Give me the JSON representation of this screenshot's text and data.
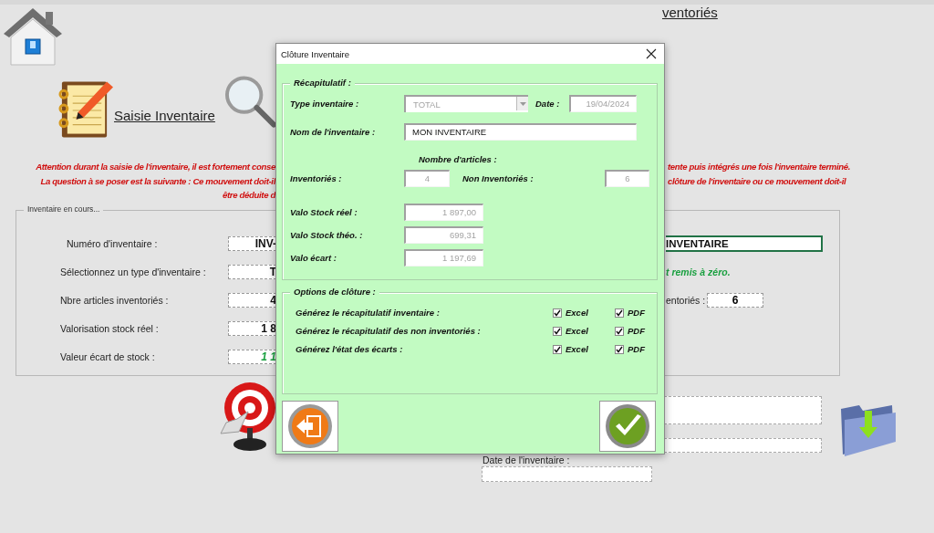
{
  "sheet": {
    "entry_link": "Saisie Inventaire",
    "inventoried_link": "ventoriés",
    "warning_lines": [
      {
        "left": "Attention durant la saisie de l'inventaire, il est fortement conse",
        "right": "tente puis intégrés une fois l'inventaire terminé."
      },
      {
        "left": "La question à se poser est la suivante : Ce mouvement doit-il",
        "right": "clôture de l'inventaire ou ce mouvement doit-il"
      },
      {
        "left": "être déduite d"
      }
    ],
    "current": {
      "legend": "Inventaire en cours...",
      "rows": [
        {
          "label": "Numéro d'inventaire :",
          "value": "INV-",
          "kind": "plain"
        },
        {
          "label": "Sélectionnez un type d'inventaire :",
          "value": "T",
          "kind": "plain"
        },
        {
          "label": "Nbre articles inventoriés :",
          "value": "4",
          "kind": "plain"
        },
        {
          "label": "Valorisation stock réel :",
          "value": "1 8",
          "kind": "plain"
        },
        {
          "label": "Valeur écart de stock :",
          "value": "1 1",
          "kind": "gain"
        }
      ],
      "name_value": "INVENTAIRE",
      "reset_notice": "t remis à zéro.",
      "not_inventoried_label": "entoriés :",
      "not_inventoried_value": "6"
    },
    "date_label": "Date de l'inventaire :"
  },
  "dialog": {
    "title": "Clôture Inventaire",
    "summary": {
      "legend": "Récapitulatif :",
      "type": {
        "label": "Type inventaire :",
        "value": "TOTAL",
        "disabled": true
      },
      "date": {
        "label": "Date :",
        "value": "19/04/2024",
        "disabled": true
      },
      "name": {
        "label": "Nom de l'inventaire :",
        "value": "MON INVENTAIRE",
        "disabled": false
      },
      "count_heading": "Nombre d'articles :",
      "inventoried": {
        "label": "Inventoriés :",
        "value": "4",
        "disabled": true
      },
      "not_inventoried": {
        "label": "Non Inventoriés :",
        "value": "6",
        "disabled": true
      },
      "valuations": [
        {
          "label": "Valo Stock réel :",
          "value": "1 897,00",
          "disabled": true
        },
        {
          "label": "Valo Stock théo. :",
          "value": "699,31",
          "disabled": true
        },
        {
          "label": "Valo écart :",
          "value": "1 197,69",
          "disabled": true
        }
      ]
    },
    "options": {
      "legend": "Options de clôture :",
      "rows": [
        {
          "label": "Générez le récapitulatif inventaire :",
          "formats": [
            {
              "label": "Excel",
              "checked": true
            },
            {
              "label": "PDF",
              "checked": true
            }
          ]
        },
        {
          "label": "Générez le récapitulatif des non inventoriés :",
          "formats": [
            {
              "label": "Excel",
              "checked": true
            },
            {
              "label": "PDF",
              "checked": true
            }
          ]
        },
        {
          "label": "Générez l'état des écarts :",
          "formats": [
            {
              "label": "Excel",
              "checked": true
            },
            {
              "label": "PDF",
              "checked": true
            }
          ]
        }
      ]
    }
  }
}
